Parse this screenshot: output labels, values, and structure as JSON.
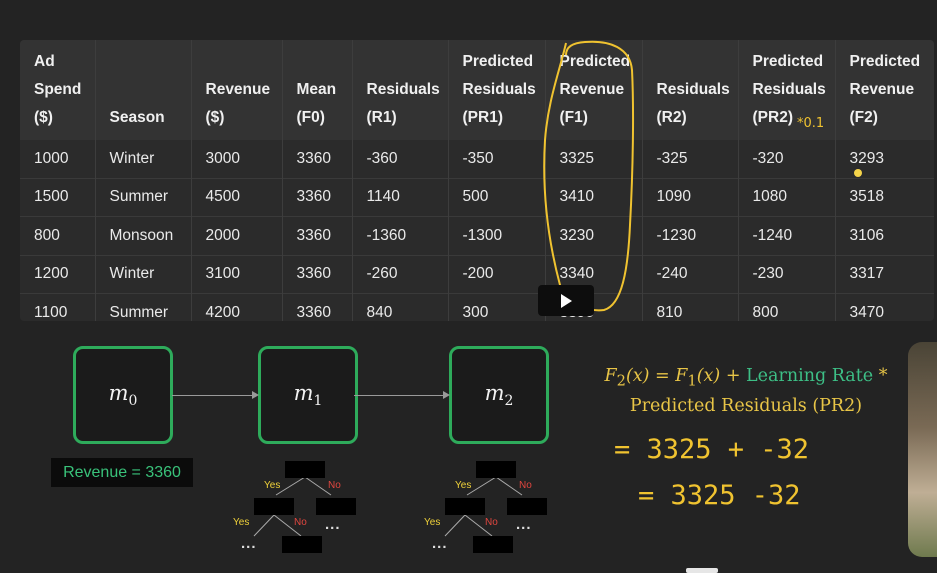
{
  "table": {
    "headers": [
      [
        "Ad",
        "Spend",
        "($)"
      ],
      [
        "Season"
      ],
      [
        "Revenue",
        "($)"
      ],
      [
        "Mean",
        "(F0)"
      ],
      [
        "Residuals",
        "(R1)"
      ],
      [
        "Predicted",
        "Residuals",
        "(PR1)"
      ],
      [
        "Predicted",
        "Revenue",
        "(F1)"
      ],
      [
        "Residuals",
        "(R2)"
      ],
      [
        "Predicted",
        "Residuals",
        "(PR2)"
      ],
      [
        "Predicted",
        "Revenue",
        "(F2)"
      ]
    ],
    "rows": [
      [
        "1000",
        "Winter",
        "3000",
        "3360",
        "-360",
        "-350",
        "3325",
        "-325",
        "-320",
        "3293"
      ],
      [
        "1500",
        "Summer",
        "4500",
        "3360",
        "1140",
        "500",
        "3410",
        "1090",
        "1080",
        "3518"
      ],
      [
        "800",
        "Monsoon",
        "2000",
        "3360",
        "-1360",
        "-1300",
        "3230",
        "-1230",
        "-1240",
        "3106"
      ],
      [
        "1200",
        "Winter",
        "3100",
        "3360",
        "-260",
        "-200",
        "3340",
        "-240",
        "-230",
        "3317"
      ],
      [
        "1100",
        "Summer",
        "4200",
        "3360",
        "840",
        "300",
        "3390",
        "810",
        "800",
        "3470"
      ]
    ],
    "annotation": "*0.1"
  },
  "models": [
    {
      "base": "m",
      "sub": "0"
    },
    {
      "base": "m",
      "sub": "1"
    },
    {
      "base": "m",
      "sub": "2"
    }
  ],
  "revenue_label": "Revenue = 3360",
  "tree": {
    "yes": "Yes",
    "no": "No",
    "more": "..."
  },
  "formula": {
    "lhs": "F",
    "lhs_sub": "2",
    "arg": "(x)",
    "eq": " = ",
    "f1": "F",
    "f1_sub": "1",
    "plus": " + ",
    "lr": "Learning Rate",
    "times": " *",
    "line2": "Predicted Residuals (PR2)"
  },
  "handwriting": {
    "line1": "= 3325 + -32",
    "line2": "= 3325 -32"
  },
  "colors": {
    "background": "#232323",
    "accent_green": "#2eab5b",
    "highlight_yellow": "#f0c330",
    "formula_yellow": "#e8c547",
    "no_red": "#e0463f"
  },
  "player": {
    "play_icon": "play-icon"
  }
}
